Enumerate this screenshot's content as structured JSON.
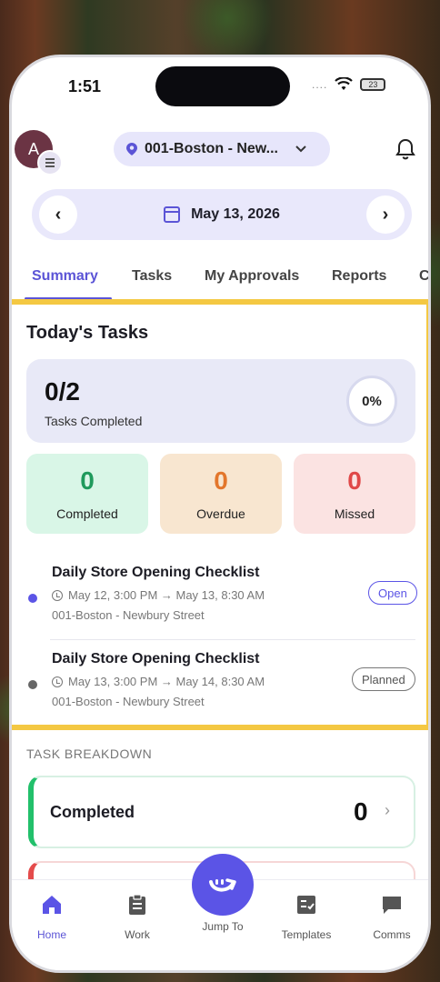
{
  "status_bar": {
    "time": "1:51",
    "signal_dots": "....",
    "battery": "23"
  },
  "header": {
    "avatar_initial": "A",
    "location": "001-Boston - New...",
    "date": "May 13, 2026"
  },
  "tabs": [
    {
      "label": "Summary",
      "active": true
    },
    {
      "label": "Tasks"
    },
    {
      "label": "My Approvals"
    },
    {
      "label": "Reports"
    },
    {
      "label": "C"
    }
  ],
  "today": {
    "title": "Today's Tasks",
    "completed_count": "0/2",
    "completed_label": "Tasks Completed",
    "percent": "0%",
    "stats": [
      {
        "value": "0",
        "label": "Completed",
        "bg": "#d9f6e7",
        "color": "#1f9a5c"
      },
      {
        "value": "0",
        "label": "Overdue",
        "bg": "#f8e6d0",
        "color": "#e3762b"
      },
      {
        "value": "0",
        "label": "Missed",
        "bg": "#fbe3e2",
        "color": "#e04848"
      }
    ],
    "tasks": [
      {
        "title": "Daily Store Opening Checklist",
        "time": "May 12, 3:00 PM → May 13, 8:30 AM",
        "location": "001-Boston - Newbury Street",
        "status": "Open",
        "dot_color": "#5b54e6"
      },
      {
        "title": "Daily Store Opening Checklist",
        "time": "May 13, 3:00 PM → May 14, 8:30 AM",
        "location": "001-Boston - Newbury Street",
        "status": "Planned",
        "dot_color": "#666666"
      }
    ]
  },
  "breakdown": {
    "title": "TASK BREAKDOWN",
    "completed_label": "Completed",
    "completed_count": "0",
    "chevron": "›"
  },
  "bottom_nav": {
    "home": "Home",
    "work": "Work",
    "jump_to": "Jump To",
    "templates": "Templates",
    "comms": "Comms"
  },
  "colors": {
    "accent": "#5b54e6",
    "highlight": "#f4c842"
  }
}
